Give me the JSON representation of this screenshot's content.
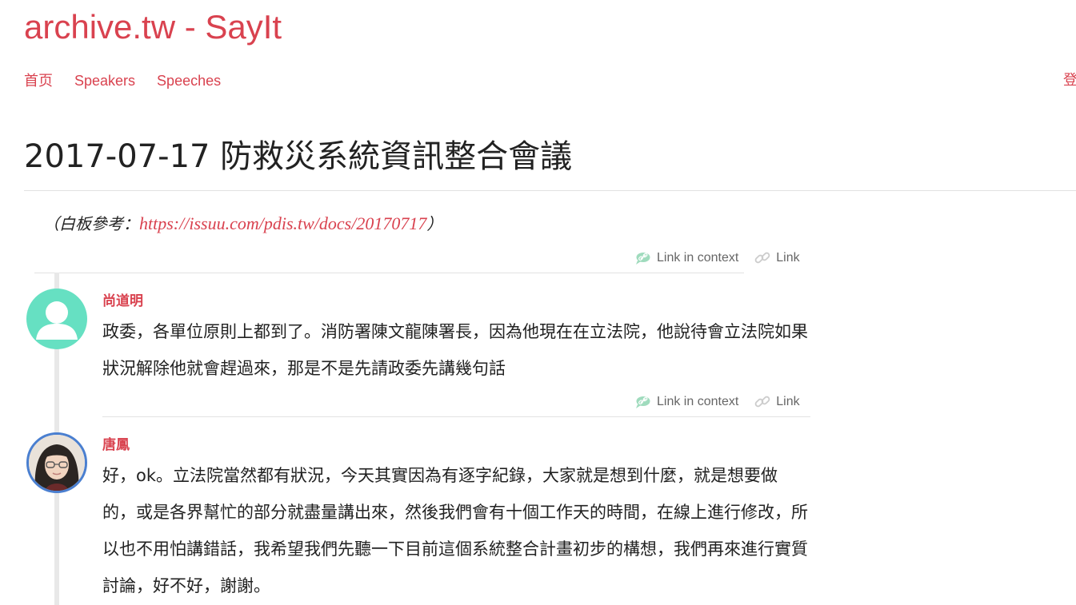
{
  "site": {
    "title": "archive.tw - SayIt"
  },
  "nav": {
    "items": [
      {
        "label": "首页"
      },
      {
        "label": "Speakers"
      },
      {
        "label": "Speeches"
      }
    ],
    "login_label": "登"
  },
  "page": {
    "title": "2017-07-17 防救災系統資訊整合會議",
    "note": {
      "prefix": "（白板參考：",
      "link": "https://issuu.com/pdis.tw/docs/20170717",
      "suffix": "）"
    }
  },
  "speech_links": {
    "context_label": "Link in context",
    "link_label": "Link"
  },
  "speeches": [
    {
      "speaker": "尚道明",
      "avatar_icon": "default-user-avatar-icon",
      "text": "政委，各單位原則上都到了。消防署陳文龍陳署長，因為他現在在立法院，他說待會立法院如果狀況解除他就會趕過來，那是不是先請政委先講幾句話"
    },
    {
      "speaker": "唐鳳",
      "avatar_icon": "speaker-photo-avatar",
      "text": "好，ok。立法院當然都有狀況，今天其實因為有逐字紀錄，大家就是想到什麼，就是想要做的，或是各界幫忙的部分就盡量講出來，然後我們會有十個工作天的時間，在線上進行修改，所以也不用怕講錯話，我希望我們先聽一下目前這個系統整合計畫初步的構想，我們再來進行實質討論，好不好，謝謝。"
    }
  ],
  "colors": {
    "accent": "#d9424f",
    "avatar_default": "#66e0c2",
    "avatar_border": "#4a7fd0",
    "link_icon": "#9fdbbd"
  }
}
